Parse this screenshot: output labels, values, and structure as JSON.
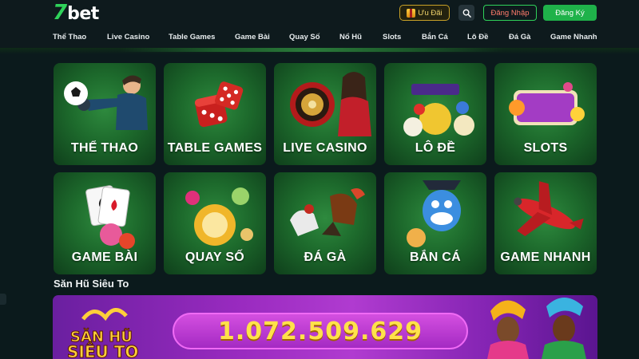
{
  "brand": {
    "logo_number": "7",
    "logo_text": "bet"
  },
  "header": {
    "promo_label": "Ưu Đãi",
    "login_label": "Đăng Nhập",
    "register_label": "Đăng Ký"
  },
  "nav": {
    "items": [
      "Thể Thao",
      "Live Casino",
      "Table Games",
      "Game Bài",
      "Quay Số",
      "Nổ Hũ",
      "Slots",
      "Bắn Cá",
      "Lô Đề",
      "Đá Gà",
      "Game Nhanh"
    ]
  },
  "tiles": [
    {
      "label": "THỂ THAO",
      "icon": "soccer-goalkeeper-icon"
    },
    {
      "label": "TABLE GAMES",
      "icon": "dice-icon"
    },
    {
      "label": "LIVE CASINO",
      "icon": "roulette-dealer-icon"
    },
    {
      "label": "LÔ ĐỀ",
      "icon": "lottery-balls-icon"
    },
    {
      "label": "SLOTS",
      "icon": "slot-777-icon"
    },
    {
      "label": "GAME BÀI",
      "icon": "playing-cards-icon"
    },
    {
      "label": "QUAY SỐ",
      "icon": "number-ball-icon"
    },
    {
      "label": "ĐÁ GÀ",
      "icon": "rooster-fight-icon"
    },
    {
      "label": "BẮN CÁ",
      "icon": "pirate-fish-icon"
    },
    {
      "label": "GAME NHANH",
      "icon": "airplane-icon"
    }
  ],
  "jackpot": {
    "section_title": "Săn Hũ Siêu To",
    "logo_line1": "SĂN HŨ",
    "logo_line2": "SIÊU TO",
    "value": "1.072.509.629"
  },
  "colors": {
    "accent": "#1fb24a",
    "background": "#0b1a1c",
    "jackpot": "#9a2bc0",
    "jackpot_text": "#ffe24a"
  }
}
